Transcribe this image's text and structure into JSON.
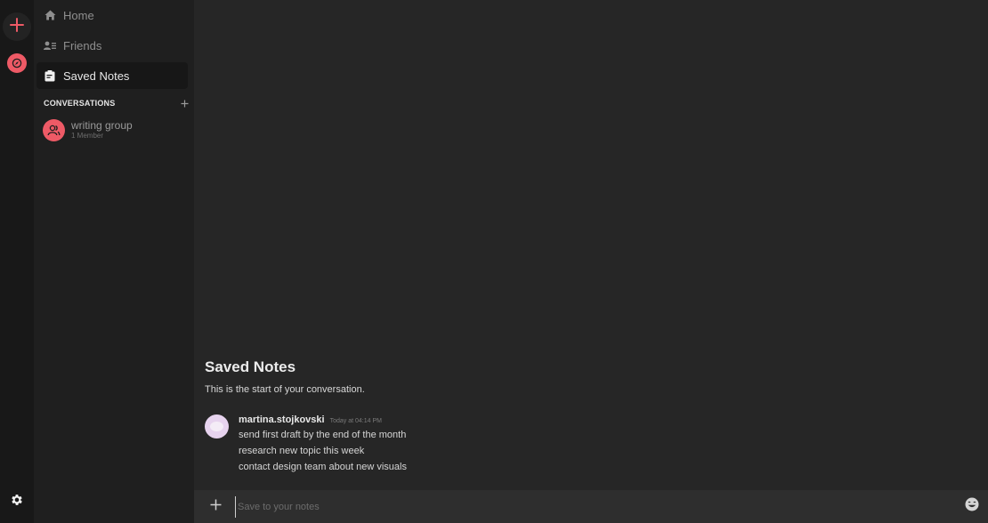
{
  "rail": {
    "add_icon": "plus-icon",
    "explore_icon": "compass-icon",
    "settings_icon": "gear-icon",
    "accent": "#ee5a66"
  },
  "sidebar": {
    "nav": [
      {
        "label": "Home",
        "icon": "home-icon"
      },
      {
        "label": "Friends",
        "icon": "friends-icon"
      },
      {
        "label": "Saved Notes",
        "icon": "notes-icon",
        "active": true
      }
    ],
    "conversations_title": "CONVERSATIONS",
    "conversations": [
      {
        "name": "writing group",
        "sub": "1 Member",
        "icon": "group-icon"
      }
    ]
  },
  "main": {
    "title": "Saved Notes",
    "subtitle": "This is the start of your conversation.",
    "message": {
      "author": "martina.stojkovski",
      "time": "Today at 04:14 PM",
      "lines": [
        "send first draft by the end of the month",
        "research new topic this week",
        "contact design team about new visuals"
      ]
    },
    "composer": {
      "placeholder": "Save to your notes"
    }
  }
}
